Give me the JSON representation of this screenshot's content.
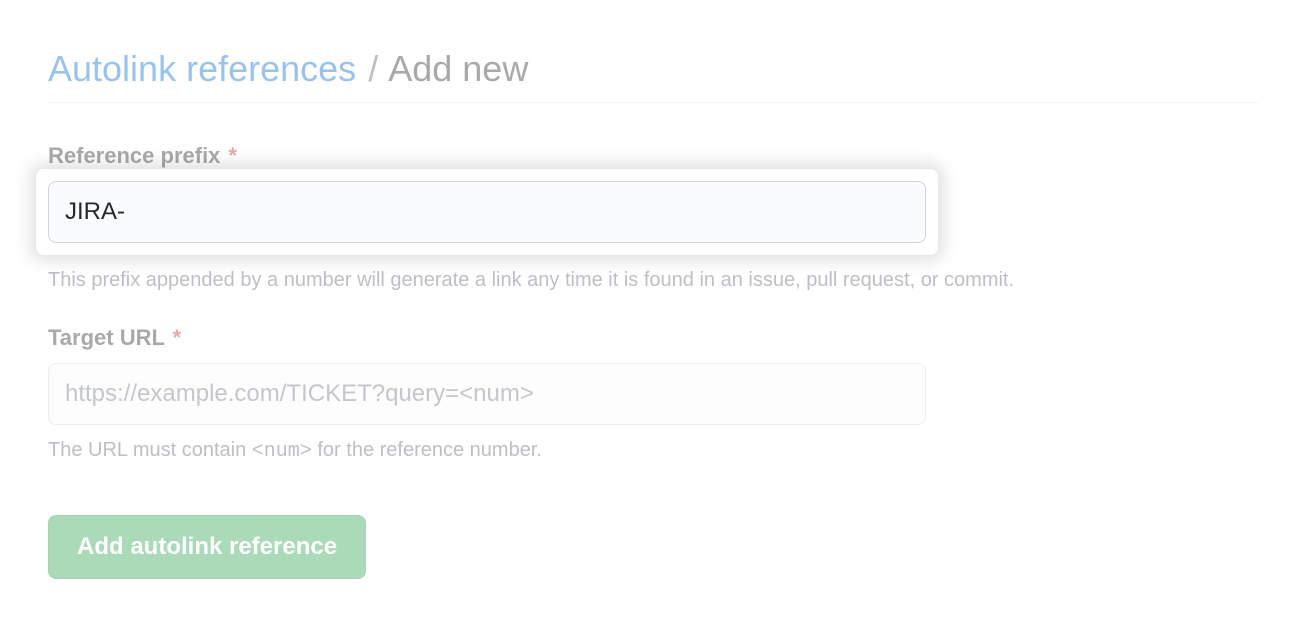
{
  "breadcrumb": {
    "parent": "Autolink references",
    "separator": "/",
    "current": "Add new"
  },
  "form": {
    "prefix": {
      "label": "Reference prefix",
      "required_marker": "*",
      "value": "JIRA-",
      "help": "This prefix appended by a number will generate a link any time it is found in an issue, pull request, or commit."
    },
    "target_url": {
      "label": "Target URL",
      "required_marker": "*",
      "placeholder": "https://example.com/TICKET?query=<num>",
      "value": "",
      "help_prefix": "The URL must contain ",
      "help_code": "<num>",
      "help_suffix": " for the reference number."
    },
    "submit_label": "Add autolink reference"
  }
}
